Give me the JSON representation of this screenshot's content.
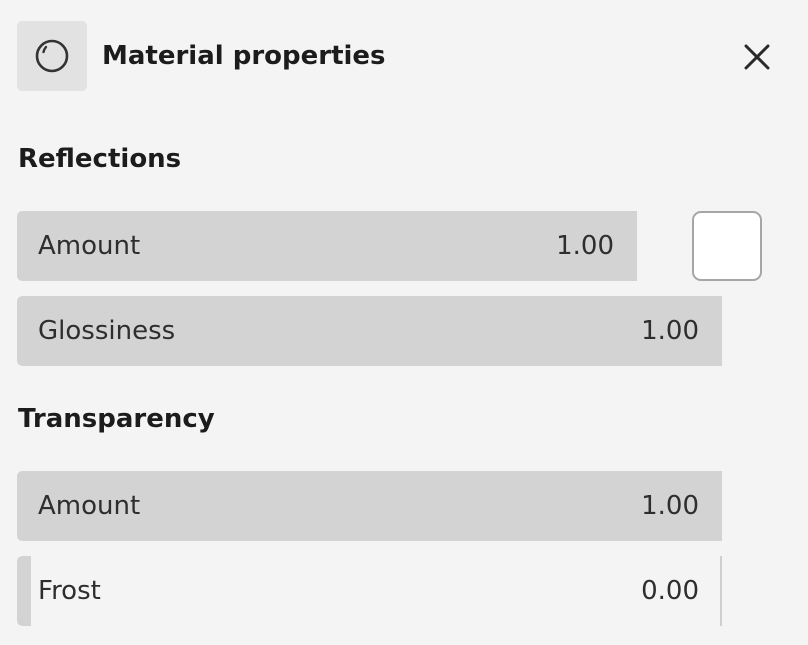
{
  "header": {
    "title": "Material properties",
    "icon": "material-sphere-icon",
    "close_icon": "close-icon"
  },
  "sections": {
    "reflections": {
      "heading": "Reflections",
      "amount": {
        "label": "Amount",
        "value": "1.00",
        "fill_fraction": 1.0
      },
      "glossiness": {
        "label": "Glossiness",
        "value": "1.00",
        "fill_fraction": 1.0
      },
      "color_swatch": {
        "color": "#ffffff"
      }
    },
    "transparency": {
      "heading": "Transparency",
      "amount": {
        "label": "Amount",
        "value": "1.00",
        "fill_fraction": 1.0
      },
      "frost": {
        "label": "Frost",
        "value": "0.00",
        "fill_fraction": 0.0
      }
    }
  },
  "colors": {
    "background": "#f4f4f4",
    "slider_fill": "#d3d3d3",
    "icon_tile": "#e2e2e2",
    "text": "#1c1c1c"
  }
}
